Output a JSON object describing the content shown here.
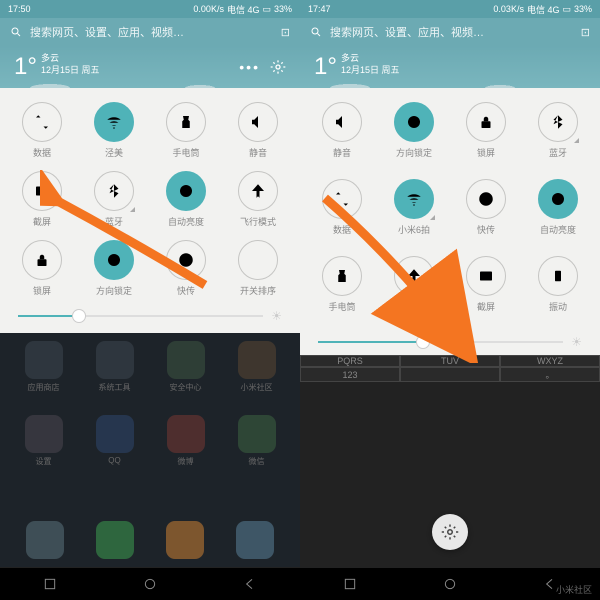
{
  "left": {
    "status": {
      "time": "17:50",
      "speed": "0.00K/s",
      "signal": "电信 4G",
      "battery": "33%"
    },
    "search": {
      "placeholder": "搜索网页、设置、应用、视频…"
    },
    "weather": {
      "temp": "1°",
      "cond": "多云",
      "date": "12月15日 周五"
    },
    "tiles": [
      {
        "label": "数据",
        "icon": "data",
        "active": false
      },
      {
        "label": "泾美",
        "icon": "wifi",
        "active": true
      },
      {
        "label": "手电筒",
        "icon": "torch",
        "active": false
      },
      {
        "label": "静音",
        "icon": "mute",
        "active": false
      },
      {
        "label": "截屏",
        "icon": "screenshot",
        "active": false
      },
      {
        "label": "蓝牙",
        "icon": "bt",
        "active": false,
        "corner": true
      },
      {
        "label": "自动亮度",
        "icon": "auto-bright",
        "active": true
      },
      {
        "label": "飞行模式",
        "icon": "airplane",
        "active": false
      },
      {
        "label": "锁屏",
        "icon": "lock",
        "active": false
      },
      {
        "label": "方向锁定",
        "icon": "rotate",
        "active": true
      },
      {
        "label": "快传",
        "icon": "transfer",
        "active": false
      },
      {
        "label": "开关排序",
        "icon": "reorder",
        "active": false
      }
    ],
    "brightness_pct": 22,
    "apps": [
      {
        "label": "应用商店",
        "color": "#3a4a5a"
      },
      {
        "label": "系统工具",
        "color": "#3a4a5a"
      },
      {
        "label": "安全中心",
        "color": "#3a5a4a"
      },
      {
        "label": "小米社区",
        "color": "#5a4a3a"
      },
      {
        "label": "设置",
        "color": "#4a4a5a"
      },
      {
        "label": "QQ",
        "color": "#2a4a7a"
      },
      {
        "label": "微博",
        "color": "#7a3a3a"
      },
      {
        "label": "微信",
        "color": "#3a6a4a"
      }
    ],
    "dock": [
      {
        "color": "#5a7a8a"
      },
      {
        "color": "#3aaa5a"
      },
      {
        "color": "#d88a3a"
      },
      {
        "color": "#5a8aaa"
      }
    ]
  },
  "right": {
    "status": {
      "time": "17:47",
      "speed": "0.03K/s",
      "signal": "电信 4G",
      "battery": "33%"
    },
    "search": {
      "placeholder": "搜索网页、设置、应用、视频…"
    },
    "weather": {
      "temp": "1°",
      "cond": "多云",
      "date": "12月15日 周五"
    },
    "tiles": [
      {
        "label": "静音",
        "icon": "mute",
        "active": false
      },
      {
        "label": "方向锁定",
        "icon": "rotate",
        "active": true
      },
      {
        "label": "锁屏",
        "icon": "lock",
        "active": false
      },
      {
        "label": "蓝牙",
        "icon": "bt",
        "active": false,
        "corner": true
      },
      {
        "label": "数据",
        "icon": "data",
        "active": false
      },
      {
        "label": "小米6拍",
        "icon": "wifi",
        "active": true,
        "corner": true
      },
      {
        "label": "快传",
        "icon": "transfer",
        "active": false
      },
      {
        "label": "自动亮度",
        "icon": "auto-bright",
        "active": true
      },
      {
        "label": "手电筒",
        "icon": "torch",
        "active": false
      },
      {
        "label": "飞行模式",
        "icon": "airplane",
        "active": false
      },
      {
        "label": "截屏",
        "icon": "screenshot",
        "active": false
      },
      {
        "label": "振动",
        "icon": "vibrate",
        "active": false
      }
    ],
    "brightness_pct": 40,
    "keyboard": [
      "PQRS",
      "TUV",
      "WXYZ",
      "123",
      "",
      "。"
    ]
  },
  "watermark": "小米社区"
}
